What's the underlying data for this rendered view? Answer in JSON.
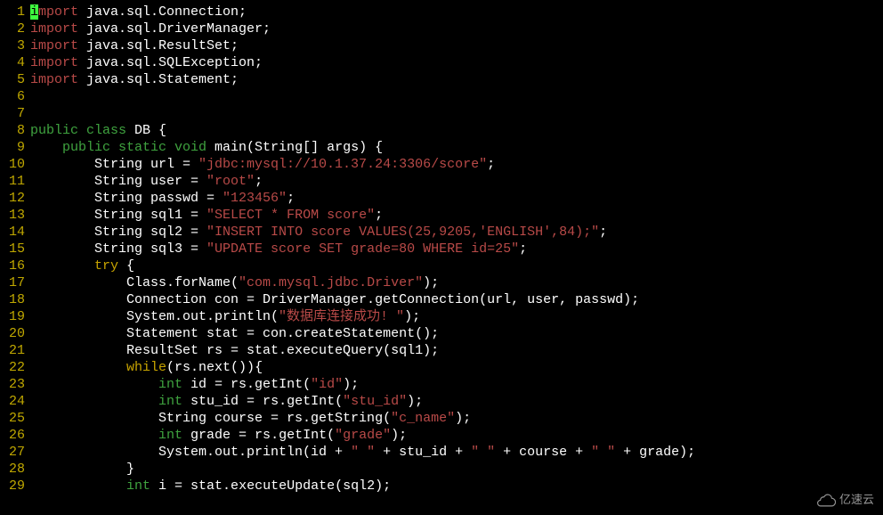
{
  "lines": [
    {
      "num": "1",
      "segs": [
        {
          "cls": "cursor",
          "t": "i"
        },
        {
          "cls": "kw-import",
          "t": "mport"
        },
        {
          "cls": "txt",
          "t": " java.sql.Connection;"
        }
      ]
    },
    {
      "num": "2",
      "segs": [
        {
          "cls": "kw-import",
          "t": "import"
        },
        {
          "cls": "txt",
          "t": " java.sql.DriverManager;"
        }
      ]
    },
    {
      "num": "3",
      "segs": [
        {
          "cls": "kw-import",
          "t": "import"
        },
        {
          "cls": "txt",
          "t": " java.sql.ResultSet;"
        }
      ]
    },
    {
      "num": "4",
      "segs": [
        {
          "cls": "kw-import",
          "t": "import"
        },
        {
          "cls": "txt",
          "t": " java.sql.SQLException;"
        }
      ]
    },
    {
      "num": "5",
      "segs": [
        {
          "cls": "kw-import",
          "t": "import"
        },
        {
          "cls": "txt",
          "t": " java.sql.Statement;"
        }
      ]
    },
    {
      "num": "6",
      "segs": [
        {
          "cls": "txt",
          "t": " "
        }
      ]
    },
    {
      "num": "7",
      "segs": [
        {
          "cls": "txt",
          "t": " "
        }
      ]
    },
    {
      "num": "8",
      "segs": [
        {
          "cls": "kw-pub",
          "t": "public class"
        },
        {
          "cls": "txt",
          "t": " DB {"
        }
      ]
    },
    {
      "num": "9",
      "segs": [
        {
          "cls": "txt",
          "t": "    "
        },
        {
          "cls": "kw-pub",
          "t": "public static void"
        },
        {
          "cls": "txt",
          "t": " main(String[] args) {"
        }
      ]
    },
    {
      "num": "10",
      "segs": [
        {
          "cls": "txt",
          "t": "        String url = "
        },
        {
          "cls": "str",
          "t": "\"jdbc:mysql://10.1.37.24:3306/score\""
        },
        {
          "cls": "txt",
          "t": ";"
        }
      ]
    },
    {
      "num": "11",
      "segs": [
        {
          "cls": "txt",
          "t": "        String user = "
        },
        {
          "cls": "str",
          "t": "\"root\""
        },
        {
          "cls": "txt",
          "t": ";"
        }
      ]
    },
    {
      "num": "12",
      "segs": [
        {
          "cls": "txt",
          "t": "        String passwd = "
        },
        {
          "cls": "str",
          "t": "\"123456\""
        },
        {
          "cls": "txt",
          "t": ";"
        }
      ]
    },
    {
      "num": "13",
      "segs": [
        {
          "cls": "txt",
          "t": "        String sql1 = "
        },
        {
          "cls": "str",
          "t": "\"SELECT * FROM score\""
        },
        {
          "cls": "txt",
          "t": ";"
        }
      ]
    },
    {
      "num": "14",
      "segs": [
        {
          "cls": "txt",
          "t": "        String sql2 = "
        },
        {
          "cls": "str",
          "t": "\"INSERT INTO score VALUES(25,9205,'ENGLISH',84);\""
        },
        {
          "cls": "txt",
          "t": ";"
        }
      ]
    },
    {
      "num": "15",
      "segs": [
        {
          "cls": "txt",
          "t": "        String sql3 = "
        },
        {
          "cls": "str",
          "t": "\"UPDATE score SET grade=80 WHERE id=25\""
        },
        {
          "cls": "txt",
          "t": ";"
        }
      ]
    },
    {
      "num": "16",
      "segs": [
        {
          "cls": "txt",
          "t": "        "
        },
        {
          "cls": "kw-ctrl",
          "t": "try"
        },
        {
          "cls": "txt",
          "t": " {"
        }
      ]
    },
    {
      "num": "17",
      "segs": [
        {
          "cls": "txt",
          "t": "            Class.forName("
        },
        {
          "cls": "str",
          "t": "\"com.mysql.jdbc.Driver\""
        },
        {
          "cls": "txt",
          "t": ");"
        }
      ]
    },
    {
      "num": "18",
      "segs": [
        {
          "cls": "txt",
          "t": "            Connection con = DriverManager.getConnection(url, user, passwd);"
        }
      ]
    },
    {
      "num": "19",
      "segs": [
        {
          "cls": "txt",
          "t": "            System.out.println("
        },
        {
          "cls": "str",
          "t": "\"数据库连接成功! \""
        },
        {
          "cls": "txt",
          "t": ");"
        }
      ]
    },
    {
      "num": "20",
      "segs": [
        {
          "cls": "txt",
          "t": "            Statement stat = con.createStatement();"
        }
      ]
    },
    {
      "num": "21",
      "segs": [
        {
          "cls": "txt",
          "t": "            ResultSet rs = stat.executeQuery(sql1);"
        }
      ]
    },
    {
      "num": "22",
      "segs": [
        {
          "cls": "txt",
          "t": "            "
        },
        {
          "cls": "kw-ctrl",
          "t": "while"
        },
        {
          "cls": "txt",
          "t": "(rs.next()){"
        }
      ]
    },
    {
      "num": "23",
      "segs": [
        {
          "cls": "txt",
          "t": "                "
        },
        {
          "cls": "kw-type",
          "t": "int"
        },
        {
          "cls": "txt",
          "t": " id = rs.getInt("
        },
        {
          "cls": "str",
          "t": "\"id\""
        },
        {
          "cls": "txt",
          "t": ");"
        }
      ]
    },
    {
      "num": "24",
      "segs": [
        {
          "cls": "txt",
          "t": "                "
        },
        {
          "cls": "kw-type",
          "t": "int"
        },
        {
          "cls": "txt",
          "t": " stu_id = rs.getInt("
        },
        {
          "cls": "str",
          "t": "\"stu_id\""
        },
        {
          "cls": "txt",
          "t": ");"
        }
      ]
    },
    {
      "num": "25",
      "segs": [
        {
          "cls": "txt",
          "t": "                String course = rs.getString("
        },
        {
          "cls": "str",
          "t": "\"c_name\""
        },
        {
          "cls": "txt",
          "t": ");"
        }
      ]
    },
    {
      "num": "26",
      "segs": [
        {
          "cls": "txt",
          "t": "                "
        },
        {
          "cls": "kw-type",
          "t": "int"
        },
        {
          "cls": "txt",
          "t": " grade = rs.getInt("
        },
        {
          "cls": "str",
          "t": "\"grade\""
        },
        {
          "cls": "txt",
          "t": ");"
        }
      ]
    },
    {
      "num": "27",
      "segs": [
        {
          "cls": "txt",
          "t": "                System.out.println(id + "
        },
        {
          "cls": "str",
          "t": "\" \""
        },
        {
          "cls": "txt",
          "t": " + stu_id + "
        },
        {
          "cls": "str",
          "t": "\" \""
        },
        {
          "cls": "txt",
          "t": " + course + "
        },
        {
          "cls": "str",
          "t": "\" \""
        },
        {
          "cls": "txt",
          "t": " + grade);"
        }
      ]
    },
    {
      "num": "28",
      "segs": [
        {
          "cls": "txt",
          "t": "            }"
        }
      ]
    },
    {
      "num": "29",
      "segs": [
        {
          "cls": "txt",
          "t": "            "
        },
        {
          "cls": "kw-type",
          "t": "int"
        },
        {
          "cls": "txt",
          "t": " i = stat.executeUpdate(sql2);"
        }
      ]
    }
  ],
  "watermark": {
    "text": "亿速云"
  }
}
